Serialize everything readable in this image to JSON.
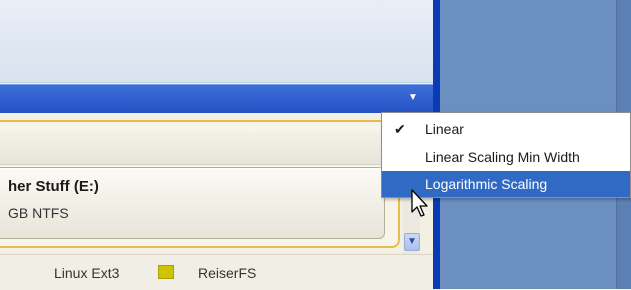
{
  "partition": {
    "name": "her Stuff (E:)",
    "info": "GB NTFS"
  },
  "legend": {
    "items": [
      {
        "label": "Linux Ext3"
      },
      {
        "label": "ReiserFS",
        "color": "#cfc400"
      }
    ]
  },
  "menu": {
    "items": [
      {
        "label": "Linear",
        "checked": true
      },
      {
        "label": "Linear Scaling Min Width",
        "checked": false
      },
      {
        "label": "Logarithmic Scaling",
        "checked": false,
        "highlighted": true
      }
    ],
    "check_glyph": "✔"
  },
  "icons": {
    "combo_arrow": "chevron-down-icon",
    "scroll_down": "chevron-down-icon",
    "cursor": "mouse-pointer-icon"
  },
  "colors": {
    "accent_blue": "#2452c6",
    "highlight": "#316ac5",
    "frame_gold": "#e8bd4d",
    "reiserfs": "#cfc400"
  }
}
